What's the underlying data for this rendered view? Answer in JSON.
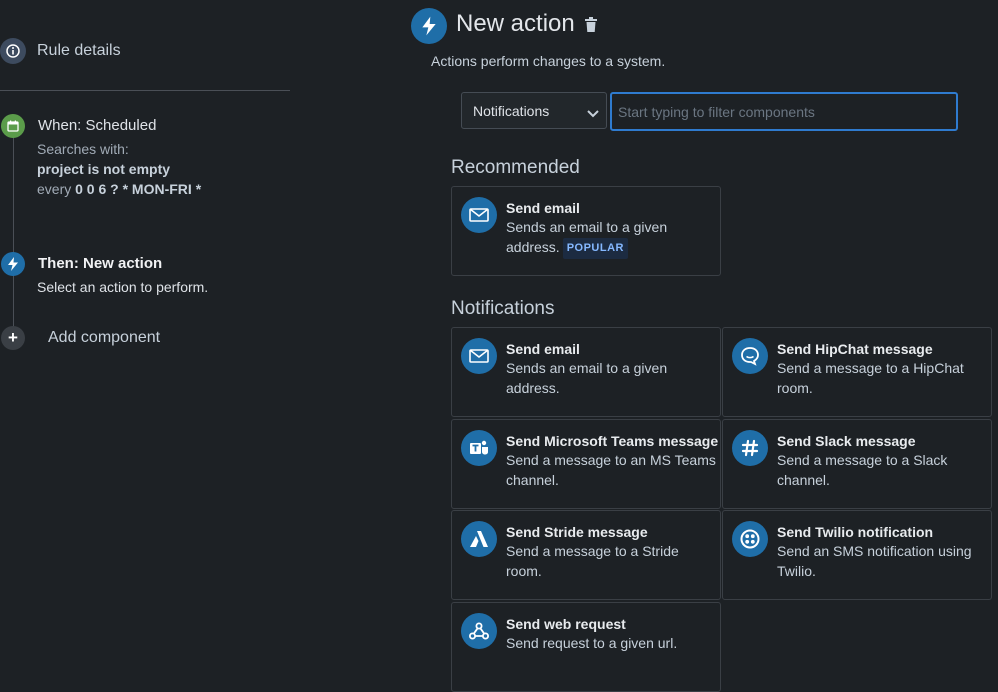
{
  "sidebar": {
    "rule_details": "Rule details",
    "trigger": {
      "title": "When: Scheduled",
      "searches_label": "Searches with:",
      "jql": "project is not empty",
      "schedule_prefix": "every",
      "cron": "0 0 6 ? * MON-FRI *"
    },
    "action": {
      "title": "Then: New action",
      "subtitle": "Select an action to perform."
    },
    "add_component": "Add component"
  },
  "header": {
    "title": "New action",
    "subtitle": "Actions perform changes to a system."
  },
  "filter": {
    "category": "Notifications",
    "placeholder": "Start typing to filter components"
  },
  "recommended": {
    "heading": "Recommended",
    "cards": [
      {
        "title": "Send email",
        "desc": "Sends an email to a given address.",
        "badge": "POPULAR",
        "icon": "envelope-icon"
      }
    ]
  },
  "notifications": {
    "heading": "Notifications",
    "cards": [
      {
        "title": "Send email",
        "desc": "Sends an email to a given address.",
        "icon": "envelope-icon"
      },
      {
        "title": "Send HipChat message",
        "desc": "Send a message to a HipChat room.",
        "icon": "hipchat-icon"
      },
      {
        "title": "Send Microsoft Teams message",
        "desc": "Send a message to an MS Teams channel.",
        "icon": "teams-icon"
      },
      {
        "title": "Send Slack message",
        "desc": "Send a message to a Slack channel.",
        "icon": "slack-icon"
      },
      {
        "title": "Send Stride message",
        "desc": "Send a message to a Stride room.",
        "icon": "stride-icon"
      },
      {
        "title": "Send Twilio notification",
        "desc": "Send an SMS notification using Twilio.",
        "icon": "twilio-icon"
      },
      {
        "title": "Send web request",
        "desc": "Send request to a given url.",
        "icon": "webhook-icon"
      }
    ]
  },
  "colors": {
    "background": "#1d2125",
    "accent": "#1f6ea8",
    "trigger_green": "#5b9c4a",
    "focus_border": "#2f7bcf",
    "badge_text": "#85b8ff"
  }
}
